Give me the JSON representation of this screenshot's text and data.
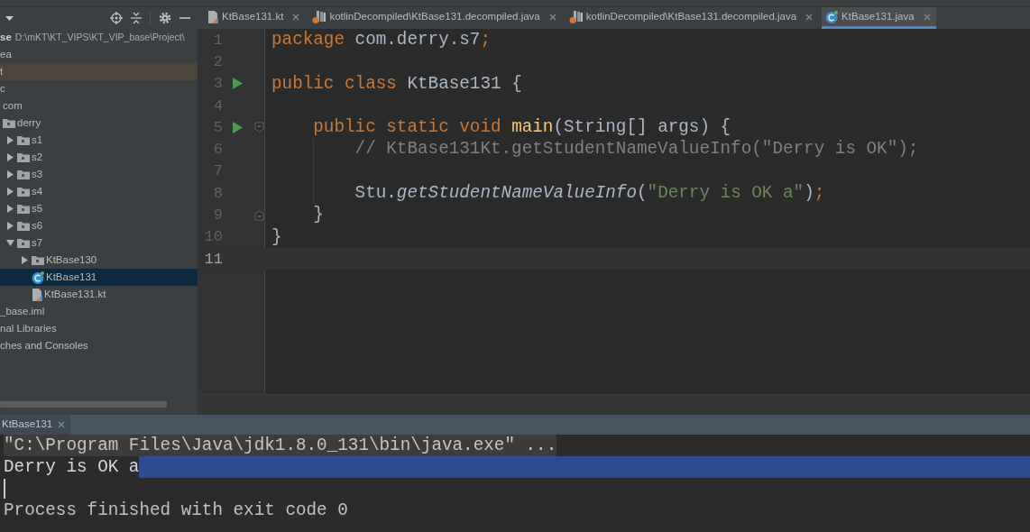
{
  "sidebar": {
    "tree": [
      {
        "label": "se",
        "path": "D:\\mKT\\KT_VIPS\\KT_VIP_base\\Project\\",
        "selected": false,
        "highlighted": false,
        "children": [
          {
            "label": "ea",
            "selected": false,
            "highlighted": false
          },
          {
            "label": "t",
            "selected": false,
            "highlighted": true
          },
          {
            "label": "c",
            "selected": false,
            "highlighted": false,
            "children": [
              {
                "label": "com",
                "selected": false,
                "highlighted": false,
                "children": [
                  {
                    "label": "derry",
                    "kind": "folder",
                    "selected": false,
                    "highlighted": false,
                    "children": [
                      {
                        "label": "s1",
                        "kind": "folder",
                        "expanded": false,
                        "selected": false,
                        "highlighted": false
                      },
                      {
                        "label": "s2",
                        "kind": "folder",
                        "expanded": false,
                        "selected": false,
                        "highlighted": false
                      },
                      {
                        "label": "s3",
                        "kind": "folder",
                        "expanded": false,
                        "selected": false,
                        "highlighted": false
                      },
                      {
                        "label": "s4",
                        "kind": "folder",
                        "expanded": false,
                        "selected": false,
                        "highlighted": false
                      },
                      {
                        "label": "s5",
                        "kind": "folder",
                        "expanded": false,
                        "selected": false,
                        "highlighted": false
                      },
                      {
                        "label": "s6",
                        "kind": "folder",
                        "expanded": false,
                        "selected": false,
                        "highlighted": false
                      },
                      {
                        "label": "s7",
                        "kind": "folder",
                        "expanded": true,
                        "selected": false,
                        "highlighted": false,
                        "children": [
                          {
                            "label": "KtBase130",
                            "kind": "folder",
                            "expanded": false,
                            "selected": false,
                            "highlighted": false
                          },
                          {
                            "label": "KtBase131",
                            "kind": "class",
                            "selected": true,
                            "highlighted": false
                          },
                          {
                            "label": "KtBase131.kt",
                            "kind": "kotlin",
                            "selected": false,
                            "highlighted": false
                          }
                        ]
                      }
                    ]
                  }
                ]
              }
            ]
          },
          {
            "label": "_base.iml",
            "selected": false,
            "highlighted": false
          }
        ]
      },
      {
        "label": "nal Libraries",
        "selected": false,
        "highlighted": false
      },
      {
        "label": "ches and Consoles",
        "selected": false,
        "highlighted": false
      }
    ]
  },
  "editor_tabs": [
    {
      "label": "KtBase131.kt",
      "kind": "kotlin",
      "selected": false
    },
    {
      "label": "kotlinDecompiled\\KtBase131.decompiled.java",
      "kind": "decompiled",
      "selected": false
    },
    {
      "label": "kotlinDecompiled\\KtBase131.decompiled.java",
      "kind": "decompiled",
      "selected": false
    },
    {
      "label": "KtBase131.java",
      "kind": "class",
      "selected": true
    }
  ],
  "editor": {
    "lines": [
      {
        "number": "1",
        "current": false,
        "run": false,
        "fold": false,
        "tokens": [
          {
            "text": "package",
            "kind": "keyword"
          },
          {
            "text": " com.derry.s7",
            "kind": "plain"
          },
          {
            "text": ";",
            "kind": "keyword"
          }
        ]
      },
      {
        "number": "2",
        "current": false,
        "run": false,
        "fold": false
      },
      {
        "number": "3",
        "current": false,
        "run": true,
        "fold": false,
        "tokens": [
          {
            "text": "public class",
            "kind": "keyword"
          },
          {
            "text": " KtBase131 {",
            "kind": "plain"
          }
        ]
      },
      {
        "number": "4",
        "current": false,
        "run": false,
        "fold": false
      },
      {
        "number": "5",
        "current": false,
        "run": true,
        "fold": true,
        "tokens": [
          {
            "text": "    public static void ",
            "kind": "keyword"
          },
          {
            "text": "main",
            "kind": "declaration"
          },
          {
            "text": "(String[] args) {",
            "kind": "plain"
          }
        ]
      },
      {
        "number": "6",
        "current": false,
        "run": false,
        "fold": false,
        "tokens": [
          {
            "text": "        // KtBase131Kt.getStudentNameValueInfo(\"Derry is OK\");",
            "kind": "comment"
          }
        ]
      },
      {
        "number": "7",
        "current": false,
        "run": false,
        "fold": false
      },
      {
        "number": "8",
        "current": false,
        "run": false,
        "fold": false,
        "tokens": [
          {
            "text": "        Stu.",
            "kind": "plain"
          },
          {
            "text": "getStudentNameValueInfo",
            "kind": "call"
          },
          {
            "text": "(",
            "kind": "plain"
          },
          {
            "text": "\"Derry is OK a\"",
            "kind": "string"
          },
          {
            "text": ")",
            "kind": "plain"
          },
          {
            "text": ";",
            "kind": "keyword"
          }
        ]
      },
      {
        "number": "9",
        "current": false,
        "run": false,
        "fold": true,
        "tokens": [
          {
            "text": "    }",
            "kind": "plain"
          }
        ]
      },
      {
        "number": "10",
        "current": false,
        "run": false,
        "fold": false,
        "tokens": [
          {
            "text": "}",
            "kind": "plain"
          }
        ]
      },
      {
        "number": "11",
        "current": true,
        "run": false,
        "fold": false
      }
    ]
  },
  "run_panel": {
    "tab": {
      "label": "KtBase131",
      "selected": true
    },
    "lines": [
      {
        "kind": "command",
        "text": "\"C:\\Program Files\\Java\\jdk1.8.0_131\\bin\\java.exe\" ...",
        "selected": false
      },
      {
        "kind": "output",
        "text": "Derry is OK a",
        "selected": true
      },
      {
        "kind": "caret",
        "selected": false
      },
      {
        "kind": "status",
        "text": "Process finished with exit code 0",
        "selected": false
      }
    ]
  }
}
